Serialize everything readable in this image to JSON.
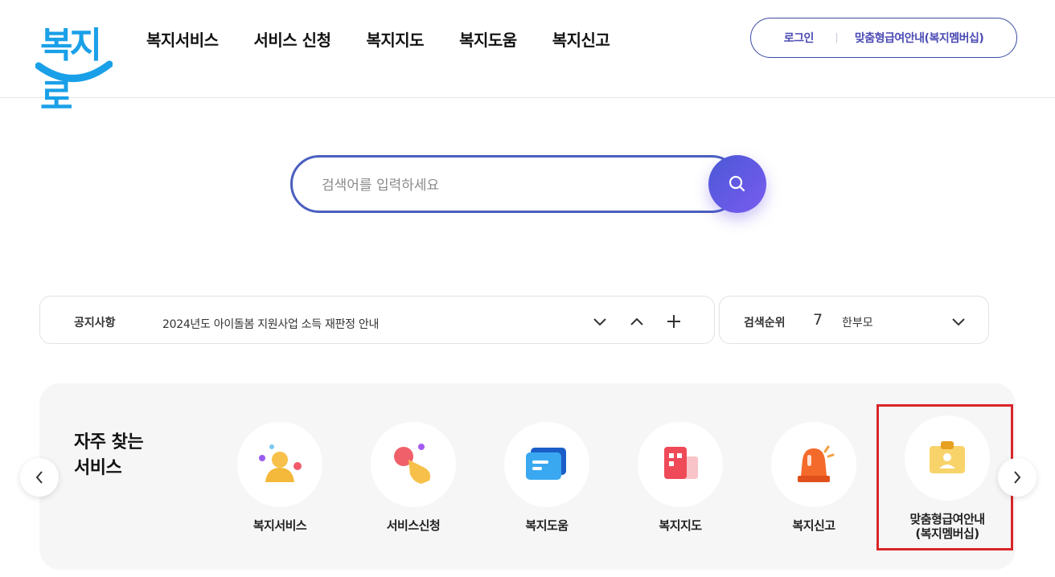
{
  "header": {
    "logo_text": "복지로",
    "nav": [
      "복지서비스",
      "서비스 신청",
      "복지지도",
      "복지도움",
      "복지신고"
    ],
    "login": "로그인",
    "membership": "맞춤형급여안내(복지멤버십)"
  },
  "search": {
    "placeholder": "검색어를 입력하세요"
  },
  "notice": {
    "label": "공지사항",
    "text": "2024년도 아이돌봄 지원사업 소득 재판정 안내"
  },
  "rank": {
    "label": "검색순위",
    "number": "7",
    "keyword": "한부모"
  },
  "frequent": {
    "title_line1": "자주 찾는",
    "title_line2": "서비스",
    "items": [
      {
        "label": "복지서비스",
        "icon": "person-icon"
      },
      {
        "label": "서비스신청",
        "icon": "tap-hand-icon"
      },
      {
        "label": "복지도움",
        "icon": "chat-card-icon"
      },
      {
        "label": "복지지도",
        "icon": "building-map-icon"
      },
      {
        "label": "복지신고",
        "icon": "siren-icon"
      },
      {
        "label_line1": "맞춤형급여안내",
        "label_line2": "(복지멤버십)",
        "icon": "id-badge-icon"
      }
    ]
  },
  "colors": {
    "accent": "#4a58d6",
    "logo": "#1aa0e8",
    "highlight": "#d9252a"
  }
}
